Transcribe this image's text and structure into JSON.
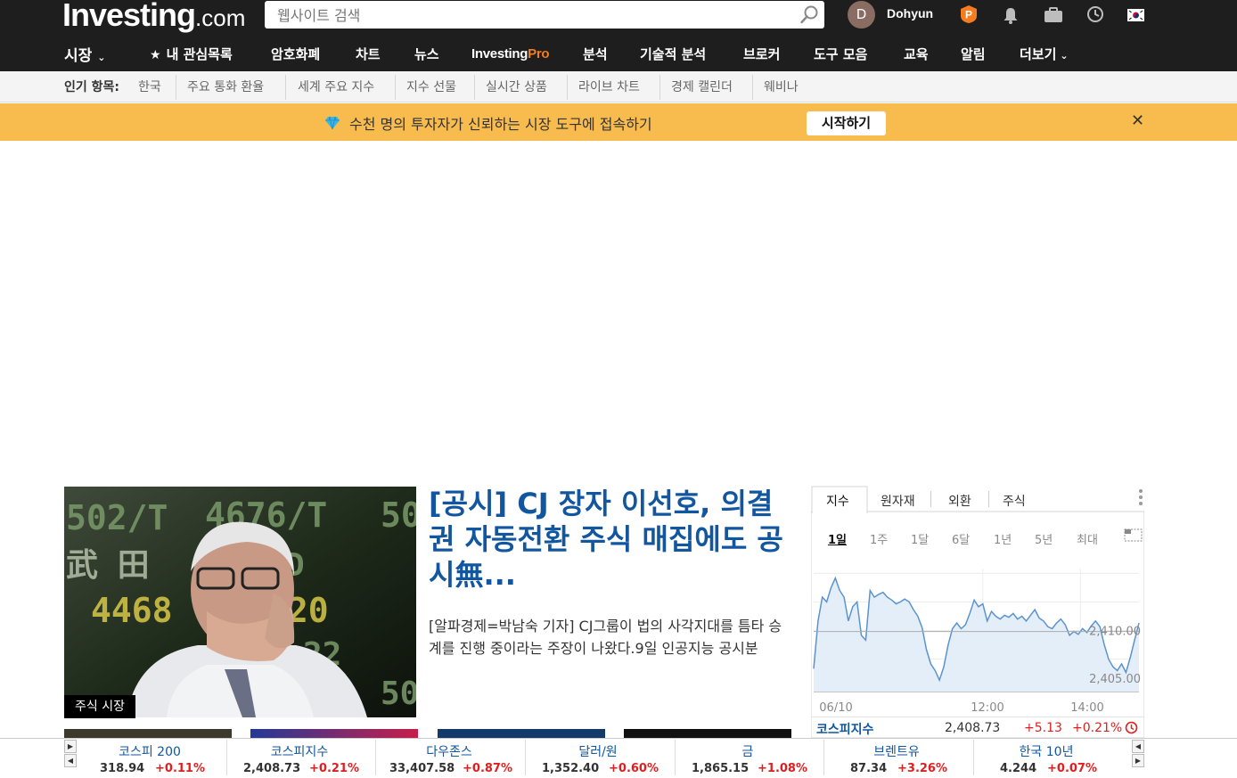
{
  "header": {
    "logo_main": "Investing",
    "logo_suffix": ".com",
    "search_placeholder": "웹사이트 검색",
    "avatar_initial": "D",
    "username": "Dohyun"
  },
  "nav": {
    "items": [
      {
        "label": "시장",
        "has_dropdown": true
      },
      {
        "label": "내 관심목록",
        "icon": "star-icon"
      },
      {
        "label": "암호화폐"
      },
      {
        "label": "차트"
      },
      {
        "label": "뉴스"
      },
      {
        "label": "InvestingPro",
        "label_main": "Investing",
        "label_pro": "Pro"
      },
      {
        "label": "분석"
      },
      {
        "label": "기술적 분석"
      },
      {
        "label": "브로커"
      },
      {
        "label": "도구 모음"
      },
      {
        "label": "교육"
      },
      {
        "label": "알림"
      },
      {
        "label": "더보기",
        "has_dropdown": true
      }
    ]
  },
  "popular": {
    "label": "인기 항목:",
    "items": [
      "한국",
      "주요 통화 환율",
      "세계 주요 지수",
      "지수 선물",
      "실시간 상품",
      "라이브 차트",
      "경제 캘린더",
      "웨비나"
    ]
  },
  "promo": {
    "icon": "diamond-icon",
    "text": "수천 명의 투자자가 신뢰하는 시장 도구에 접속하기",
    "button": "시작하기",
    "close": "✕"
  },
  "article": {
    "tag": "주식 시장",
    "headline": "[공시] CJ 장자 이선호, 의결권 자동전환 주식 매집에도 공시無...",
    "summary": "[알파경제=박남숙 기자] CJ그룹이 법의 사각지대를 틈타 승계를 진행 중이라는 주장이 나왔다.9일 인공지능 공시분",
    "image_board_texts": [
      "502/T",
      "4676/T",
      "50",
      "武 田",
      "D",
      "4468",
      "720",
      "22",
      "50"
    ]
  },
  "widget": {
    "tabs": [
      "지수",
      "원자재",
      "외환",
      "주식"
    ],
    "active_tab": 0,
    "ranges": [
      "1일",
      "1주",
      "1달",
      "6달",
      "1년",
      "5년",
      "최대"
    ],
    "active_range": 0,
    "x_labels": [
      "06/10",
      "12:00",
      "14:00"
    ],
    "y_labels": [
      "2,410.00",
      "2,405.00"
    ],
    "row": {
      "name": "코스피지수",
      "value": "2,408.73",
      "change": "+5.13",
      "pct": "+0.21%"
    },
    "colors": {
      "line": "#5b93d0",
      "fill": "#e4eef8",
      "up": "#e01e1e"
    }
  },
  "chart_data": {
    "type": "area",
    "title": "",
    "xlabel": "",
    "ylabel": "",
    "x_ticks": [
      "06/10",
      "12:00",
      "14:00"
    ],
    "y_ticks": [
      2410.0,
      2405.0
    ],
    "ylim": [
      2403.6,
      2416.5
    ],
    "values": [
      2406.0,
      2411.0,
      2413.5,
      2413.0,
      2414.5,
      2415.5,
      2414.2,
      2413.5,
      2411.0,
      2412.5,
      2413.0,
      2409.5,
      2409.0,
      2414.2,
      2413.5,
      2413.8,
      2414.0,
      2413.5,
      2413.2,
      2412.8,
      2413.0,
      2413.3,
      2413.0,
      2412.2,
      2411.5,
      2410.3,
      2408.0,
      2406.5,
      2405.8,
      2404.8,
      2406.2,
      2408.5,
      2410.2,
      2410.8,
      2410.2,
      2410.6,
      2411.8,
      2413.2,
      2412.5,
      2412.8,
      2411.0,
      2412.0,
      2411.5,
      2411.2,
      2411.6,
      2411.4,
      2411.8,
      2411.2,
      2411.5,
      2411.0,
      2411.6,
      2412.2,
      2411.3,
      2411.0,
      2410.4,
      2410.2,
      2410.8,
      2411.2,
      2410.6,
      2409.5,
      2409.9,
      2409.6,
      2410.2,
      2409.8,
      2410.5,
      2411.0,
      2410.4,
      2408.5,
      2407.0,
      2406.2,
      2405.8,
      2406.5,
      2405.6,
      2407.2,
      2409.0,
      2410.8
    ],
    "reference_line": 2409.9,
    "grid": true
  },
  "ticker": [
    {
      "name": "코스피 200",
      "value": "318.94",
      "change": "+0.11%"
    },
    {
      "name": "코스피지수",
      "value": "2,408.73",
      "change": "+0.21%"
    },
    {
      "name": "다우존스",
      "value": "33,407.58",
      "change": "+0.87%"
    },
    {
      "name": "달러/원",
      "value": "1,352.40",
      "change": "+0.60%"
    },
    {
      "name": "금",
      "value": "1,865.15",
      "change": "+1.08%"
    },
    {
      "name": "브렌트유",
      "value": "87.34",
      "change": "+3.26%"
    },
    {
      "name": "한국 10년",
      "value": "4.244",
      "change": "+0.07%"
    }
  ]
}
